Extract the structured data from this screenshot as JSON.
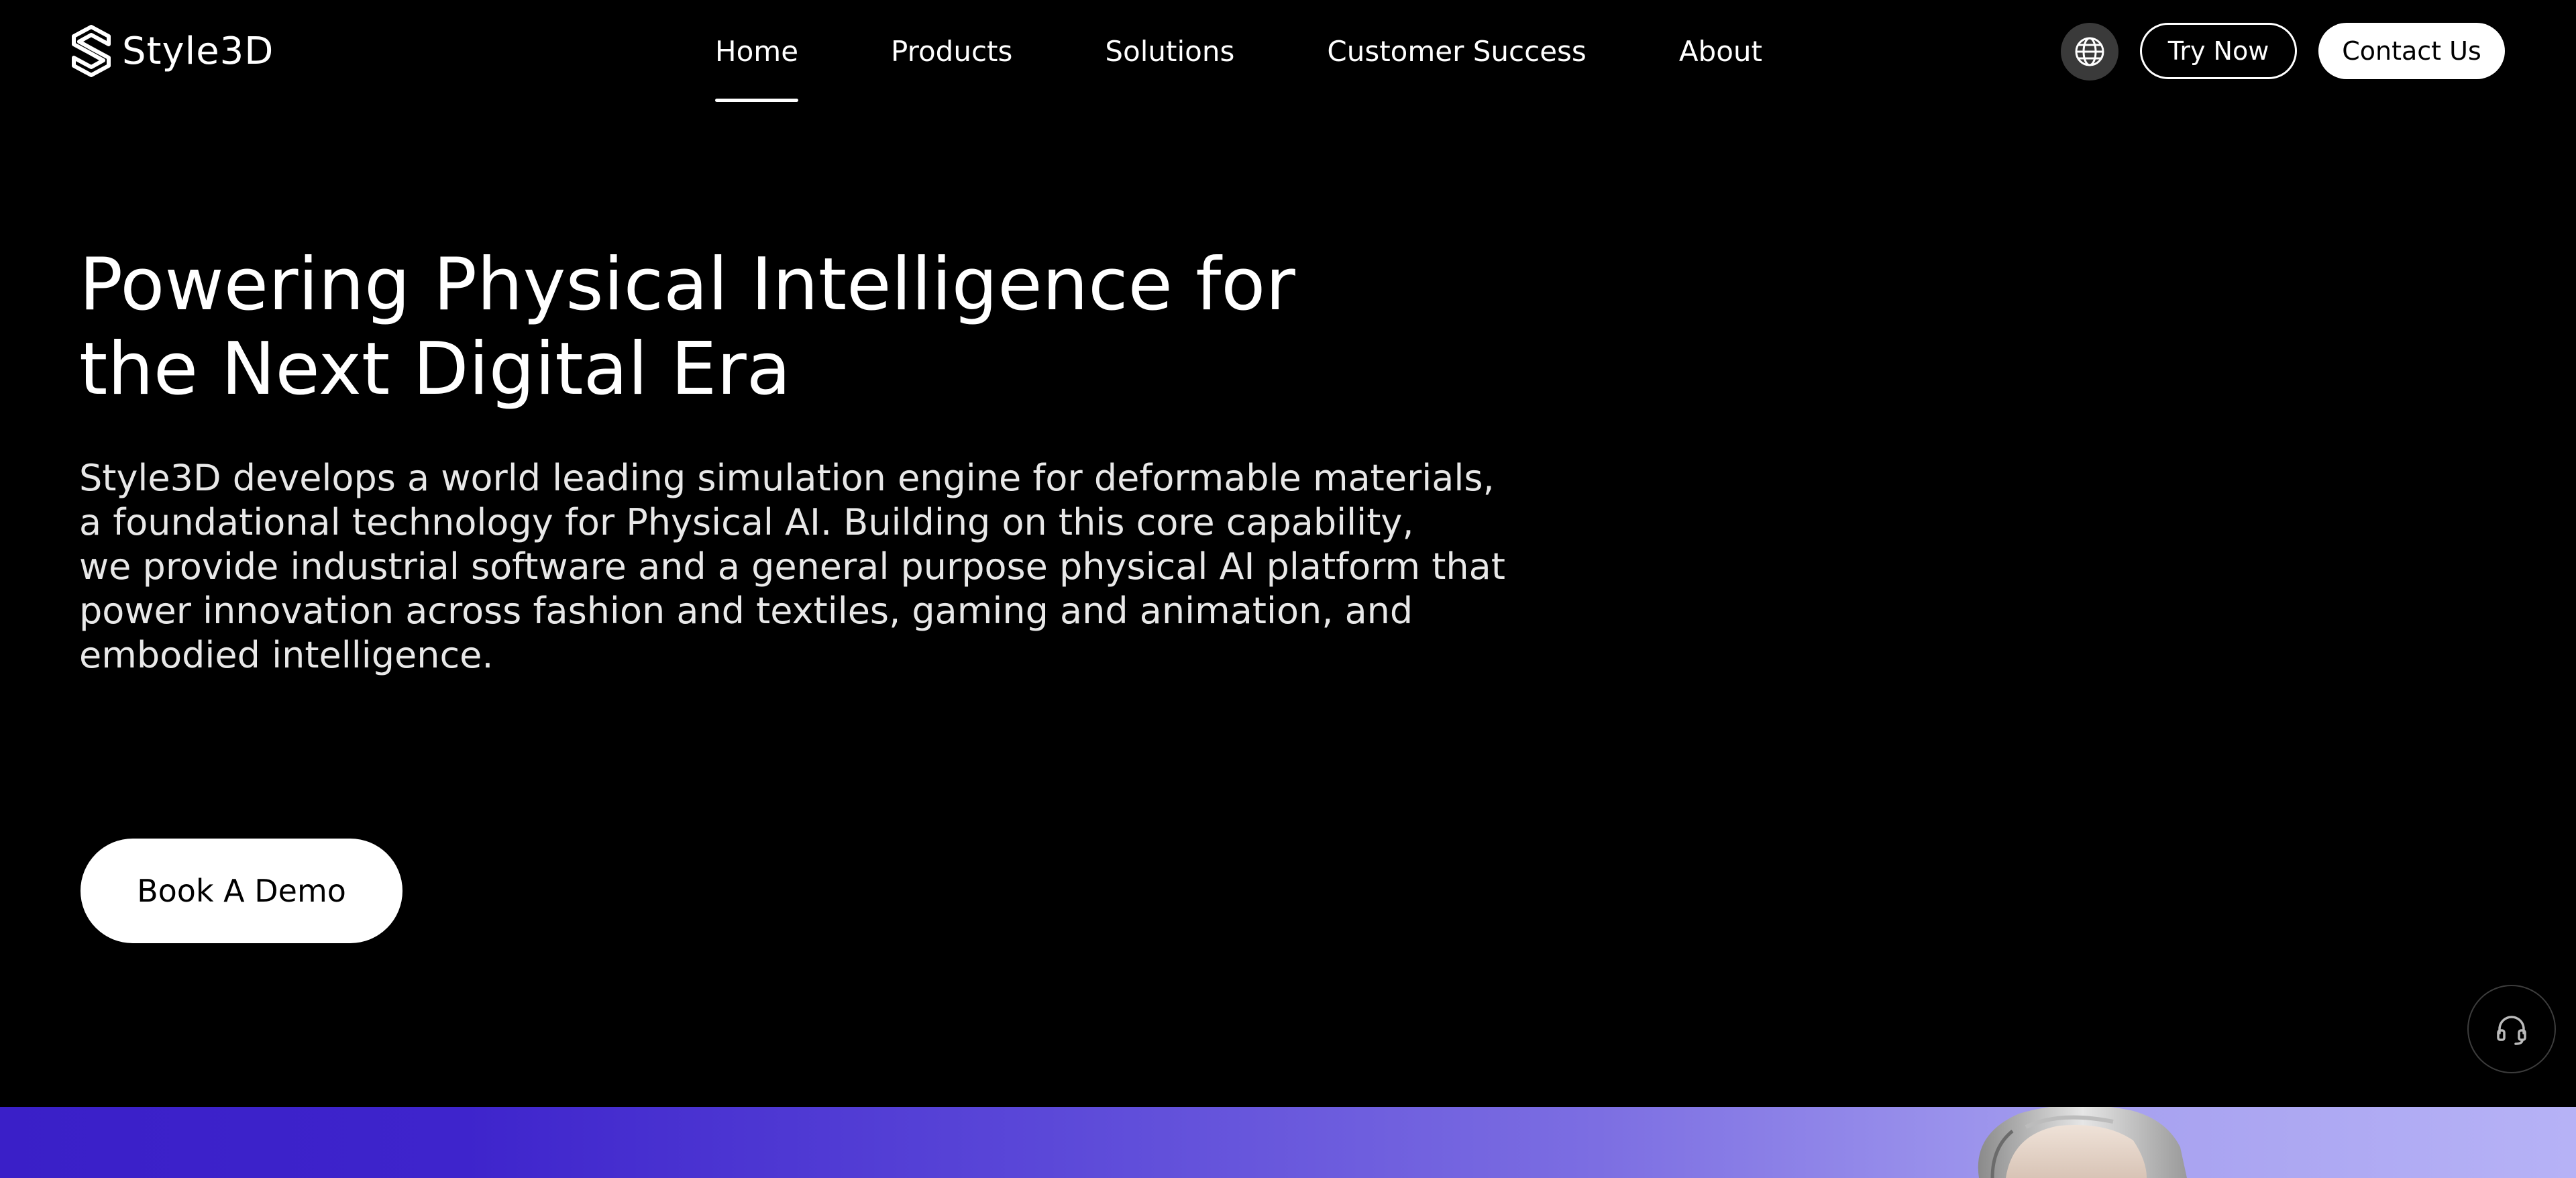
{
  "brand": {
    "name": "Style3D"
  },
  "nav": {
    "links": [
      {
        "label": "Home",
        "active": true
      },
      {
        "label": "Products",
        "active": false
      },
      {
        "label": "Solutions",
        "active": false
      },
      {
        "label": "Customer Success",
        "active": false
      },
      {
        "label": "About",
        "active": false
      }
    ],
    "language_icon": "globe-icon",
    "try_label": "Try Now",
    "contact_label": "Contact Us"
  },
  "hero": {
    "title_lines": [
      "Powering Physical Intelligence for",
      "the Next Digital Era"
    ],
    "description_lines": [
      "Style3D develops a world leading simulation engine for deformable materials,",
      "a foundational technology for Physical AI. Building on this core capability,",
      "we provide industrial software and a general purpose physical AI platform that",
      "power innovation across fashion and textiles, gaming and animation, and",
      "embodied intelligence."
    ],
    "cta_label": "Book A Demo"
  },
  "support": {
    "icon": "headset-icon"
  },
  "colors": {
    "background": "#000000",
    "text": "#ffffff",
    "band_start": "#3a1fc8",
    "band_end": "#b6b2f6",
    "globe_bg": "#3a3a3a"
  }
}
